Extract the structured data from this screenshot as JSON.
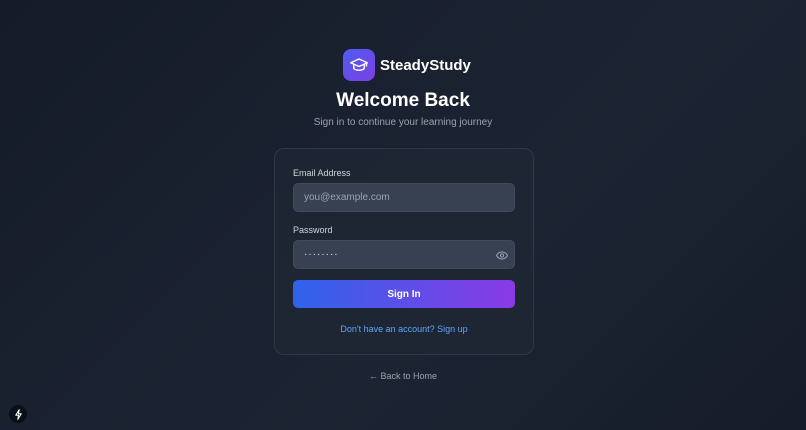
{
  "brand": {
    "name": "SteadyStudy",
    "logo_icon": "graduation-cap-icon",
    "accent_start": "#4f5cf0",
    "accent_end": "#7b3fe4"
  },
  "heading": {
    "title": "Welcome Back",
    "subtitle": "Sign in to continue your learning journey"
  },
  "form": {
    "email_label": "Email Address",
    "email_placeholder": "you@example.com",
    "email_value": "",
    "password_label": "Password",
    "password_value": "········",
    "password_toggle_icon": "eye-icon",
    "submit_label": "Sign In",
    "signup_link": "Don't have an account? Sign up"
  },
  "footer": {
    "back_link": "← Back to Home",
    "corner_icon": "lightning-bolt-icon"
  }
}
